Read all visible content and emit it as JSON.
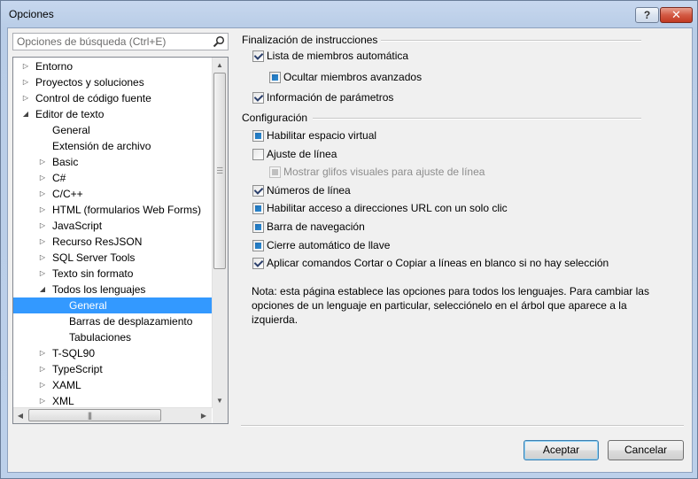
{
  "window": {
    "title": "Opciones",
    "help_label": "?",
    "close_label": "✕"
  },
  "search": {
    "placeholder": "Opciones de búsqueda (Ctrl+E)"
  },
  "tree": {
    "items": [
      {
        "label": "Entorno",
        "level": 0,
        "expander": "collapsed"
      },
      {
        "label": "Proyectos y soluciones",
        "level": 0,
        "expander": "collapsed"
      },
      {
        "label": "Control de código fuente",
        "level": 0,
        "expander": "collapsed"
      },
      {
        "label": "Editor de texto",
        "level": 0,
        "expander": "expanded"
      },
      {
        "label": "General",
        "level": 1,
        "expander": "none"
      },
      {
        "label": "Extensión de archivo",
        "level": 1,
        "expander": "none"
      },
      {
        "label": "Basic",
        "level": 1,
        "expander": "collapsed"
      },
      {
        "label": "C#",
        "level": 1,
        "expander": "collapsed"
      },
      {
        "label": "C/C++",
        "level": 1,
        "expander": "collapsed"
      },
      {
        "label": "HTML (formularios Web Forms)",
        "level": 1,
        "expander": "collapsed"
      },
      {
        "label": "JavaScript",
        "level": 1,
        "expander": "collapsed"
      },
      {
        "label": "Recurso ResJSON",
        "level": 1,
        "expander": "collapsed"
      },
      {
        "label": "SQL Server Tools",
        "level": 1,
        "expander": "collapsed"
      },
      {
        "label": "Texto sin formato",
        "level": 1,
        "expander": "collapsed"
      },
      {
        "label": "Todos los lenguajes",
        "level": 1,
        "expander": "expanded"
      },
      {
        "label": "General",
        "level": 2,
        "expander": "none",
        "selected": true
      },
      {
        "label": "Barras de desplazamiento",
        "level": 2,
        "expander": "none"
      },
      {
        "label": "Tabulaciones",
        "level": 2,
        "expander": "none"
      },
      {
        "label": "T-SQL90",
        "level": 1,
        "expander": "collapsed"
      },
      {
        "label": "TypeScript",
        "level": 1,
        "expander": "collapsed"
      },
      {
        "label": "XAML",
        "level": 1,
        "expander": "collapsed"
      },
      {
        "label": "XML",
        "level": 1,
        "expander": "collapsed"
      }
    ]
  },
  "statement_completion": {
    "header": "Finalización de instrucciones",
    "options": [
      {
        "label": "Lista de miembros automática",
        "state": "checked"
      },
      {
        "label": "Ocultar miembros avanzados",
        "state": "partial"
      },
      {
        "label": "Información de parámetros",
        "state": "checked"
      }
    ]
  },
  "settings": {
    "header": "Configuración",
    "options": [
      {
        "label": "Habilitar espacio virtual",
        "state": "partial"
      },
      {
        "label": "Ajuste de línea",
        "state": "unchecked"
      },
      {
        "label": "Mostrar glifos visuales para ajuste de línea",
        "state": "partial",
        "disabled": true
      },
      {
        "label": "Números de línea",
        "state": "checked"
      },
      {
        "label": "Habilitar acceso a direcciones URL con un solo clic",
        "state": "partial"
      },
      {
        "label": "Barra de navegación",
        "state": "partial"
      },
      {
        "label": "Cierre automático de llave",
        "state": "partial"
      },
      {
        "label": "Aplicar comandos Cortar o Copiar a líneas en blanco si no hay selección",
        "state": "checked"
      }
    ]
  },
  "note": "Nota: esta página establece las opciones para todos los lenguajes. Para cambiar las opciones de un lenguaje en particular, selecciónelo en el árbol que aparece a la izquierda.",
  "buttons": {
    "ok": "Aceptar",
    "cancel": "Cancelar"
  },
  "colors": {
    "selection": "#3399ff",
    "title_gradient": "#c7d7ee",
    "close_button": "#c23a22"
  }
}
